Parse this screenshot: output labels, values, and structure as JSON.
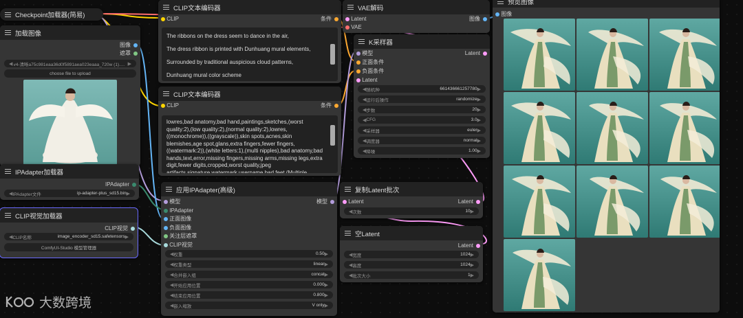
{
  "colors": {
    "clip": "#ffd500",
    "conditioning": "#ffa931",
    "model": "#b39ddb",
    "latent": "#ff9cf9",
    "vae": "#ff6e6e",
    "image": "#64b5f6",
    "mask": "#81c784",
    "ipadapter": "#3a8a6e",
    "clipvision": "#a8dadc"
  },
  "nodes": {
    "checkpoint": {
      "title": "Checkpoint加载器(简易)"
    },
    "load_image": {
      "title": "加载图像",
      "out_image": "图像",
      "out_mask": "遮罩",
      "filename": "v4-清晰a75c981eaa36d0f5891aea023eaaa_720w (1).webp",
      "upload": "choose file to upload"
    },
    "ipadapter_loader": {
      "title": "IPAdapter加载器",
      "out": "IPAdapter",
      "w_label": "IPAdapter文件",
      "w_value": "ip-adapter-plus_sd15.bin"
    },
    "clipvision": {
      "title": "CLIP视觉加载器",
      "out": "CLIP视觉",
      "w_label": "CLIP名称",
      "w_value": "image_encoder_sd15.safetensors",
      "btn": "ComfyUI-Studio 模型管理器"
    },
    "clip_pos": {
      "title": "CLIP文本编码器",
      "in": "CLIP",
      "out": "条件",
      "lines": [
        "The ribbons on the dress seem to dance in the air,",
        "The dress ribbon is printed with Dunhuang mural elements,",
        "Surrounded by traditional auspicious cloud patterns,",
        "Dunhuang mural color scheme"
      ]
    },
    "clip_neg": {
      "title": "CLIP文本编码器",
      "in": "CLIP",
      "out": "条件",
      "text": "lowres,bad anatomy,bad hand,paintings,sketches,(worst quality:2),(low quality:2),(normal quality:2),lowres,((monochrome)),((grayscale)),skin spots,acnes,skin blemishes,age spot,glans,extra fingers,fewer fingers,((watermark:2)),(white letters:1),(multi nipples),bad anatomy,bad hands,text,error,missing fingers,missing arms,missing legs,extra digit,fewer digits,cropped,worst quality,jpeg artifacts,signature,watermark,username,bad feet,(Multiple"
    },
    "ipadapter_apply": {
      "title": "应用IPAdapter(高级)",
      "out": "模型",
      "inputs": [
        "模型",
        "IPAdapter",
        "正面图像",
        "负面图像",
        "关注层遮罩",
        "CLIP视觉"
      ],
      "widgets": [
        [
          "权重",
          "0.50"
        ],
        [
          "权重类型",
          "linear"
        ],
        [
          "合并嵌入组",
          "concat"
        ],
        [
          "开始应用位置",
          "0.000"
        ],
        [
          "结束应用位置",
          "0.800"
        ],
        [
          "嵌入缩放",
          "V only"
        ]
      ]
    },
    "vae_decode": {
      "title": "VAE解码",
      "in1": "Latent",
      "in2": "VAE",
      "out": "图像"
    },
    "ksampler": {
      "title": "K采样器",
      "out": "Latent",
      "inputs": [
        "模型",
        "正面条件",
        "负面条件",
        "Latent"
      ],
      "widgets": [
        [
          "随机种",
          "661436661257780"
        ],
        [
          "运行后操作",
          "randomize"
        ],
        [
          "步数",
          "20"
        ],
        [
          "CFG",
          "3.0"
        ],
        [
          "采样器",
          "euler"
        ],
        [
          "调度器",
          "normal"
        ],
        [
          "降噪",
          "1.00"
        ]
      ]
    },
    "repeat_latent": {
      "title": "复制Latent批次",
      "in": "Latent",
      "out": "Latent",
      "w_label": "次数",
      "w_value": "10"
    },
    "empty_latent": {
      "title": "空Latent",
      "out": "Latent",
      "widgets": [
        [
          "宽度",
          "1024"
        ],
        [
          "高度",
          "1024"
        ],
        [
          "批次大小",
          "1"
        ]
      ]
    },
    "preview": {
      "title": "预览图像",
      "in": "图像"
    }
  },
  "watermark": {
    "text": "大数跨境"
  }
}
